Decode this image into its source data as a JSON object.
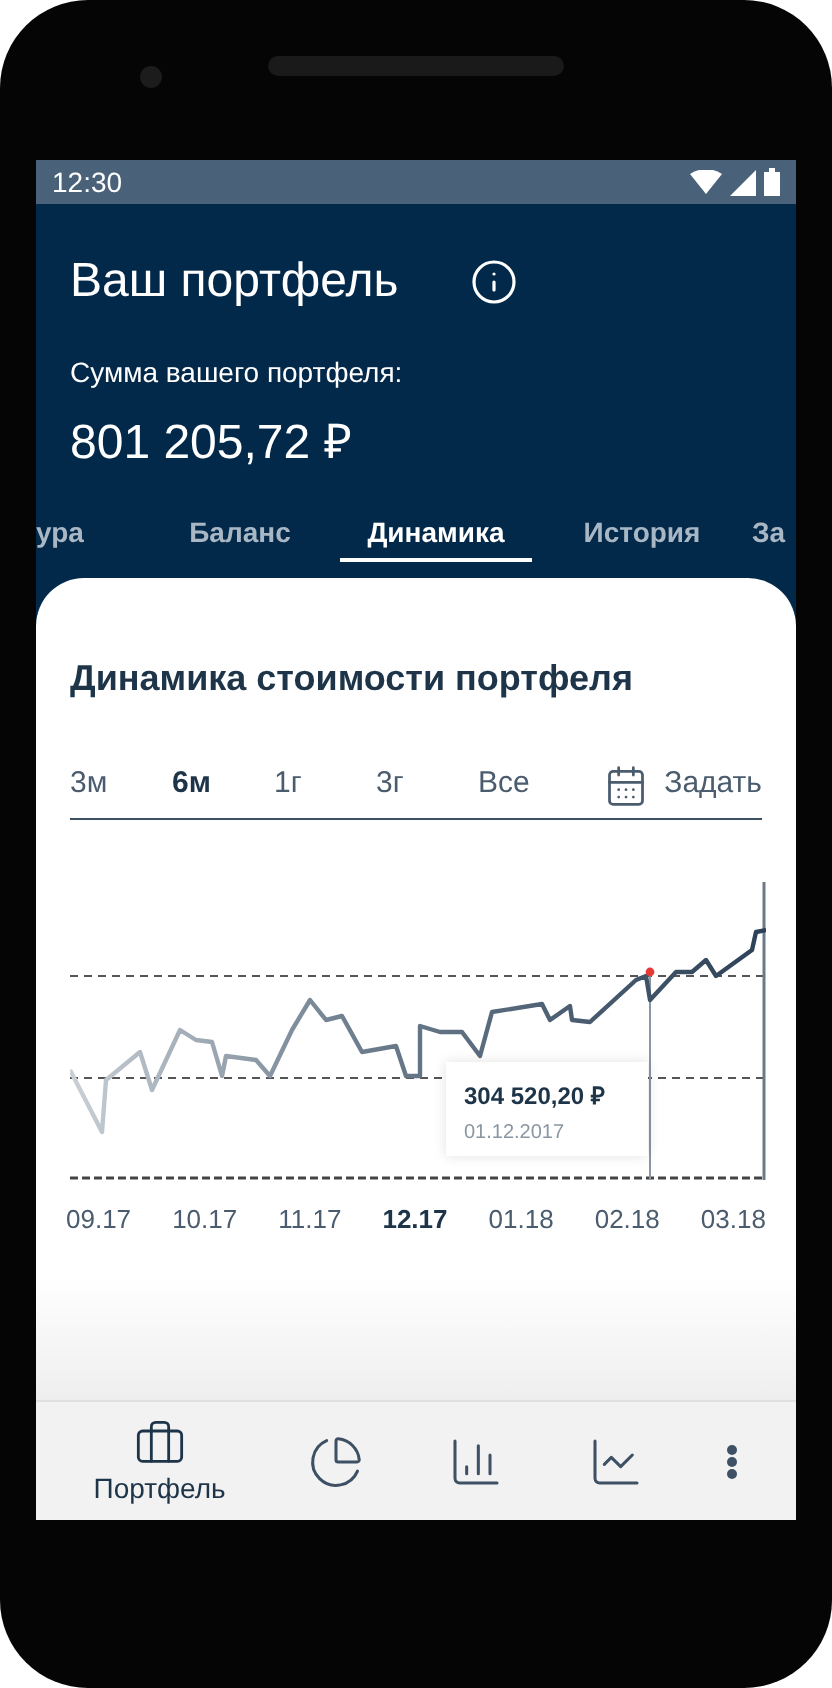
{
  "status_bar": {
    "time": "12:30"
  },
  "header": {
    "title": "Ваш портфель",
    "sum_label": "Сумма вашего портфеля:",
    "sum": "801 205,72 ₽"
  },
  "tabs": [
    {
      "label": "ура",
      "selected": false
    },
    {
      "label": "Баланс",
      "selected": false
    },
    {
      "label": "Динамика",
      "selected": true
    },
    {
      "label": "История",
      "selected": false
    },
    {
      "label": "За",
      "selected": false
    }
  ],
  "card": {
    "title": "Динамика стоимости портфеля",
    "periods": [
      {
        "label": "3м",
        "selected": false
      },
      {
        "label": "6м",
        "selected": true
      },
      {
        "label": "1г",
        "selected": false
      },
      {
        "label": "3г",
        "selected": false
      },
      {
        "label": "Все",
        "selected": false
      }
    ],
    "custom_period": "Задать",
    "x_labels": [
      {
        "label": "09.17",
        "selected": false
      },
      {
        "label": "10.17",
        "selected": false
      },
      {
        "label": "11.17",
        "selected": false
      },
      {
        "label": "12.17",
        "selected": true
      },
      {
        "label": "01.18",
        "selected": false
      },
      {
        "label": "02.18",
        "selected": false
      },
      {
        "label": "03.18",
        "selected": false
      }
    ],
    "tooltip": {
      "value": "304 520,20 ₽",
      "date": "01.12.2017"
    }
  },
  "bottom_nav": [
    {
      "kind": "briefcase",
      "label": "Портфель",
      "selected": true
    },
    {
      "kind": "pie",
      "selected": false
    },
    {
      "kind": "bars",
      "selected": false
    },
    {
      "kind": "trend",
      "selected": false
    },
    {
      "kind": "more",
      "selected": false
    }
  ]
}
